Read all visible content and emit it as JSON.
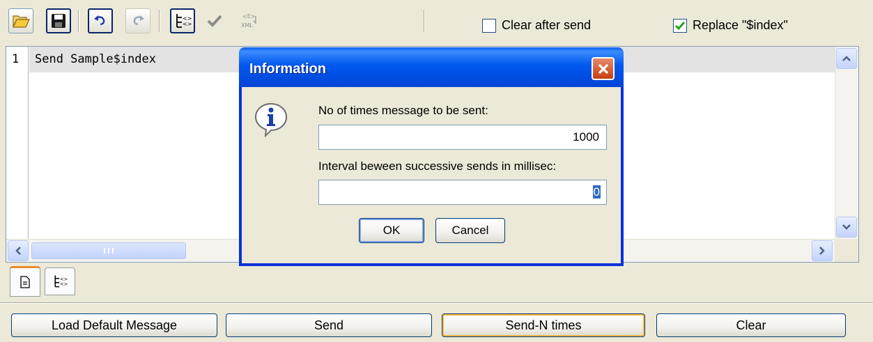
{
  "toolbar": {
    "buttons": [
      {
        "name": "open-folder",
        "icon": "folder-open-icon"
      },
      {
        "name": "save",
        "icon": "floppy-save-icon"
      },
      {
        "name": "undo",
        "icon": "undo-icon"
      },
      {
        "name": "redo",
        "icon": "redo-icon"
      },
      {
        "name": "tree-view",
        "icon": "tree-view-icon"
      },
      {
        "name": "validate",
        "icon": "checkmark-icon"
      },
      {
        "name": "xml-format",
        "icon": "xml-icon"
      }
    ],
    "clear_after_send": {
      "label": "Clear after send",
      "checked": false
    },
    "replace_index": {
      "label": "Replace \"$index\"",
      "checked": true
    }
  },
  "editor": {
    "lines": [
      {
        "number": "1",
        "text": "Send Sample$index"
      }
    ],
    "hscroll_thumb_grip": "III"
  },
  "view_tabs": [
    {
      "name": "text-view",
      "icon": "document-icon",
      "selected": true
    },
    {
      "name": "tree-view",
      "icon": "tree-view-icon",
      "selected": false
    }
  ],
  "actions": {
    "load_default": "Load Default Message",
    "send": "Send",
    "send_n_times": "Send-N times",
    "clear": "Clear"
  },
  "dialog": {
    "title": "Information",
    "icon": "info-icon",
    "count_label": "No of times message to be sent:",
    "count_value": "1000",
    "interval_label": "Interval beween successive sends in millisec:",
    "interval_value": "0",
    "ok_label": "OK",
    "cancel_label": "Cancel"
  },
  "colors": {
    "window_bg": "#ece9d8",
    "title_blue": "#0058ee",
    "close_red": "#c73c12",
    "focus_orange": "#f8b540",
    "selection_blue": "#316ac5",
    "checkbox_green": "#21a121"
  }
}
